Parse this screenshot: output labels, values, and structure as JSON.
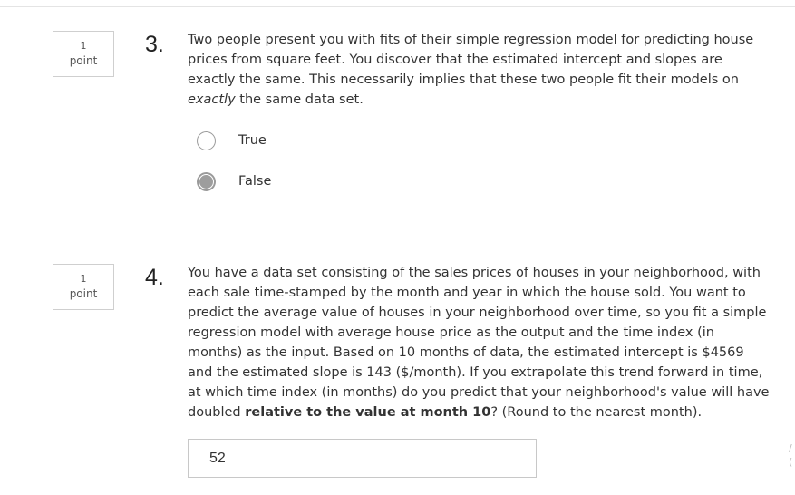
{
  "questions": [
    {
      "number": "3.",
      "points_value": "1",
      "points_label": "point",
      "text_part1": "Two people present you with fits of their simple regression model for predicting house prices from square feet. You discover that the estimated intercept and slopes are exactly the same. This necessarily implies that these two people fit their models on ",
      "text_emphasis": "exactly",
      "text_part2": " the same data set.",
      "options": [
        {
          "label": "True",
          "selected": false
        },
        {
          "label": "False",
          "selected": true
        }
      ]
    },
    {
      "number": "4.",
      "points_value": "1",
      "points_label": "point",
      "text_part1": "You have a data set consisting of the sales prices of houses in your neighborhood, with each sale time-stamped by the month and year in which the house sold. You want to predict the average value of houses in your neighborhood over time, so you fit a simple regression model with average house price as the output and the time index (in months) as the input. Based on 10 months of data, the estimated intercept is $4569 and the estimated slope is 143 ($/month). If you extrapolate this trend forward in time, at which time index (in months) do you predict that your neighborhood's value will have doubled ",
      "text_strong": "relative to the value at month 10",
      "text_part2": "? (Round to the nearest month).",
      "answer_value": "52"
    }
  ],
  "edge_marks": [
    "/",
    "("
  ]
}
